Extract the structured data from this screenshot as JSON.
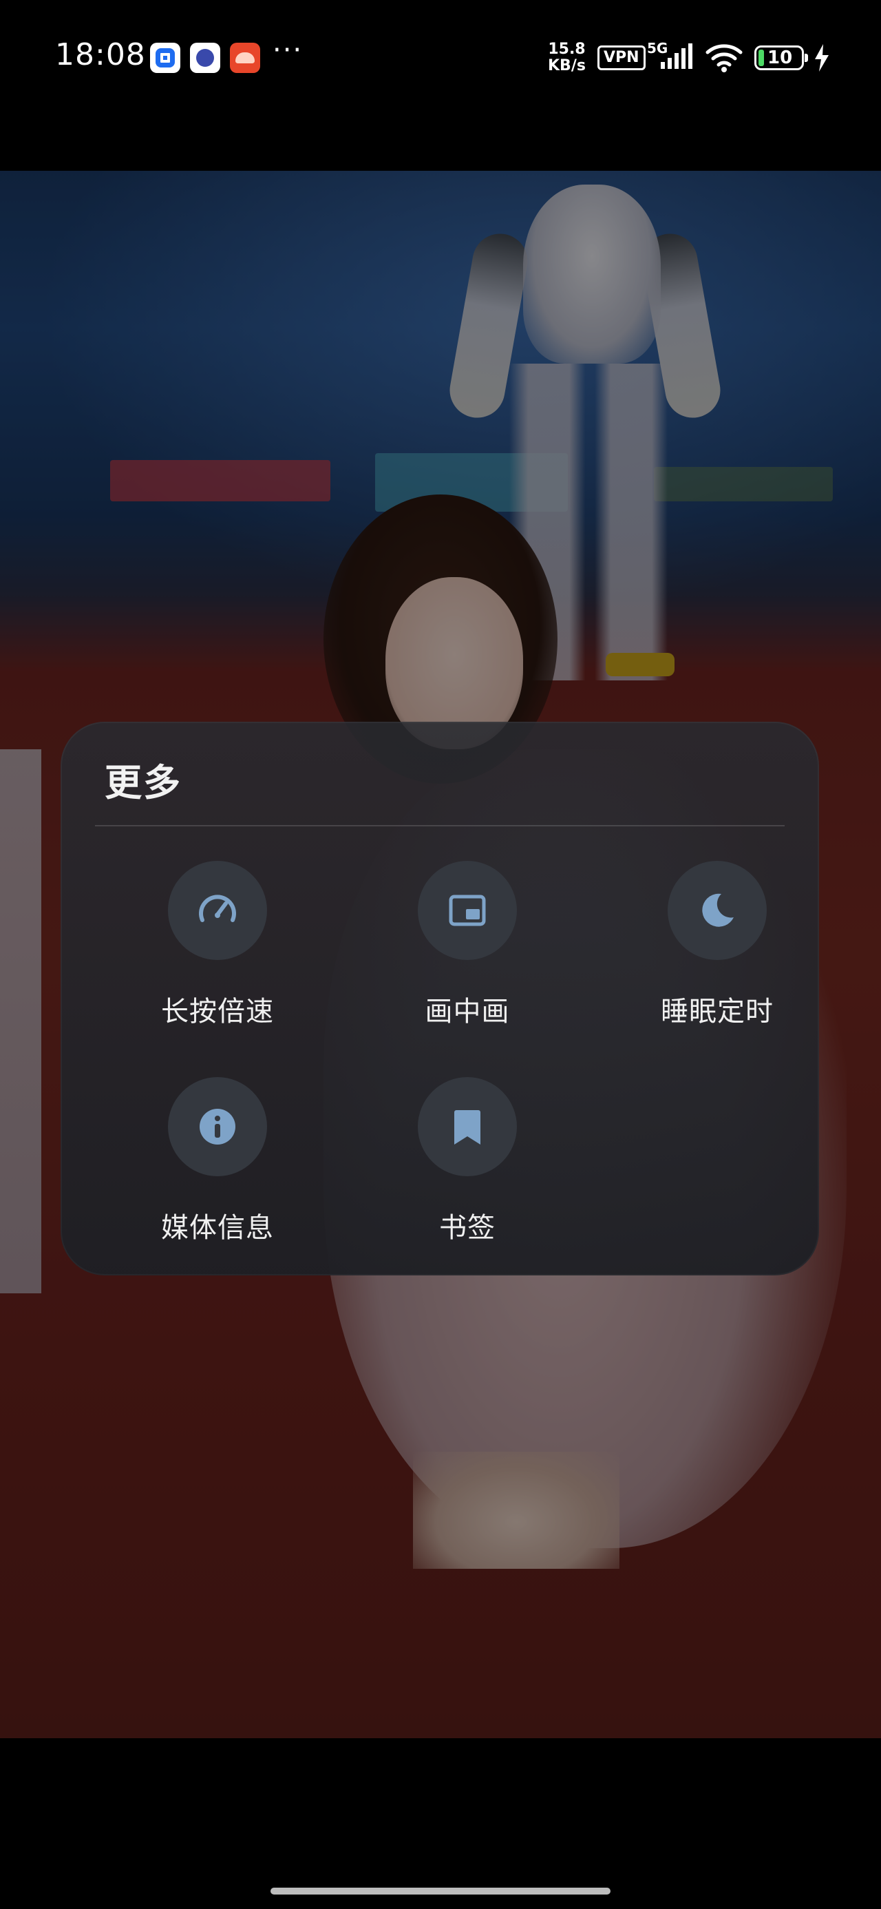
{
  "status_bar": {
    "time": "18:08",
    "more_indicator": "···",
    "net_speed_value": "15.8",
    "net_speed_unit": "KB/s",
    "vpn": "VPN",
    "network_type": "5G",
    "battery_level": "10",
    "icons": [
      "app-notification-icon",
      "app-notification-icon",
      "app-notification-icon",
      "signal-icon",
      "wifi-icon",
      "battery-icon",
      "charging-icon"
    ]
  },
  "more_panel": {
    "title": "更多",
    "options": [
      {
        "label": "长按倍速",
        "icon": "speedometer-icon"
      },
      {
        "label": "画中画",
        "icon": "picture-in-picture-icon"
      },
      {
        "label": "睡眠定时",
        "icon": "moon-icon"
      },
      {
        "label": "媒体信息",
        "icon": "info-icon"
      },
      {
        "label": "书签",
        "icon": "bookmark-icon"
      }
    ],
    "icon_color": "#7ea3c8",
    "icon_bg_color": "#34383f"
  }
}
